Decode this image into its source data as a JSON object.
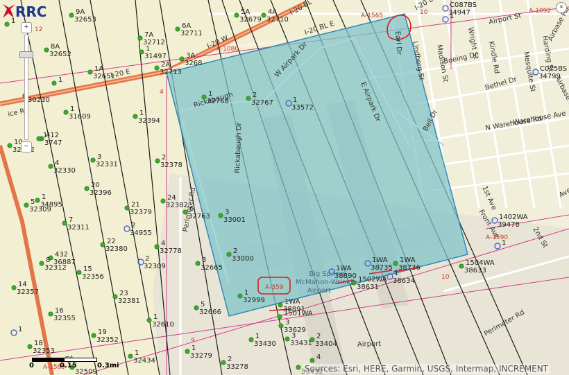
{
  "colors": {
    "background": "#f3efd2",
    "parcel_fill": "#7ec4c9",
    "parcel_stroke": "#2e8ab8",
    "highway": "#e4754b",
    "well_green": "#3cab2b",
    "permit_blue": "#4966c8",
    "survey_line": "#ce3e8b"
  },
  "zoom_control": {
    "plus": "+",
    "minus": "−"
  },
  "scale_bar": {
    "labels": [
      "0",
      "0.15",
      "0.3mi"
    ]
  },
  "attribution": "Sources: Esri, HERE, Garmin, USGS, Intermap, INCREMENT",
  "close_symbol": "×",
  "roads": [
    {
      "text": "I-20 W",
      "rot": -24
    },
    {
      "text": "I-20 E",
      "rot": -12
    },
    {
      "text": "I-20 BL E",
      "rot": -18
    },
    {
      "text": "I-20 BL",
      "rot": -30
    },
    {
      "text": "I-20 E",
      "rot": -30
    },
    {
      "text": "W Airpark Dr",
      "rot": -48
    },
    {
      "text": "E Airpark Dr",
      "rot": 68
    },
    {
      "text": "Rickabaugh Dr",
      "rot": -88
    },
    {
      "text": "Rickabaugh",
      "rot": -16
    },
    {
      "text": "Perimeter Rd",
      "rot": -80
    },
    {
      "text": "Perimeter Rd",
      "rot": -30
    },
    {
      "text": "Bell Dr",
      "rot": -62
    },
    {
      "text": "N Warehouse Rd",
      "rot": -10
    },
    {
      "text": "Warehouse Ave",
      "rot": -10
    },
    {
      "text": "Bethel Dr",
      "rot": -16
    },
    {
      "text": "Boeing Dr",
      "rot": -12
    },
    {
      "text": "Lindberg St",
      "rot": 80
    },
    {
      "text": "Madison St",
      "rot": 80
    },
    {
      "text": "Wright St",
      "rot": 80
    },
    {
      "text": "Kindle Rd",
      "rot": 80
    },
    {
      "text": "Airport St",
      "rot": -12
    },
    {
      "text": "Mesquite St",
      "rot": 80
    },
    {
      "text": "Harding St",
      "rot": 80
    },
    {
      "text": "Airbase Rd",
      "rot": -62
    },
    {
      "text": "Airbase Rd",
      "rot": 62
    },
    {
      "text": "Earl Dr",
      "rot": 86
    },
    {
      "text": "1st Ave",
      "rot": 66
    },
    {
      "text": "Front Ave",
      "rot": 58
    },
    {
      "text": "2nd St",
      "rot": 60
    },
    {
      "text": "Aven",
      "rot": -30
    },
    {
      "text": "Airport",
      "rot": -2
    },
    {
      "text": "Trl",
      "rot": -12
    },
    {
      "text": "ice Rd",
      "rot": -12
    }
  ],
  "survey_labels": [
    "A-1080",
    "A-1590",
    "A-359",
    "A-1589",
    "A-1565",
    "A-1092",
    "4",
    "10",
    "10",
    "9",
    "12"
  ],
  "airport_label": {
    "line1": "Big Spring",
    "line2": "McMahon-Wrinkle",
    "line3": "Airport"
  },
  "wells": [
    {
      "num": "9A",
      "id": "32653",
      "type": "green"
    },
    {
      "num": "6A",
      "id": "32711",
      "type": "green"
    },
    {
      "num": "7A",
      "id": "32712",
      "type": "green"
    },
    {
      "num": "1",
      "id": "31497",
      "type": "green"
    },
    {
      "num": "8A",
      "id": "32652",
      "type": "green"
    },
    {
      "num": "3A",
      "id": "3268",
      "type": "green"
    },
    {
      "num": "2A",
      "id": "32713",
      "type": "green"
    },
    {
      "num": "1A",
      "id": "32651",
      "type": "green"
    },
    {
      "num": "5A",
      "id": "32679",
      "type": "green"
    },
    {
      "num": "4A",
      "id": "32710",
      "type": "green"
    },
    {
      "num": "1",
      "id": "",
      "type": "green"
    },
    {
      "num": "1",
      "id": "",
      "type": "green"
    },
    {
      "num": "",
      "id": "30230",
      "type": "green"
    },
    {
      "num": "1",
      "id": "31609",
      "type": "green"
    },
    {
      "num": "1",
      "id": "32394",
      "type": "green"
    },
    {
      "num": "1",
      "id": "32768",
      "type": "green"
    },
    {
      "num": "2",
      "id": "32767",
      "type": "green"
    },
    {
      "num": "1",
      "id": "33572",
      "type": "blue"
    },
    {
      "num": "10",
      "id": "32332",
      "type": "green"
    },
    {
      "num": "412",
      "id": "3747",
      "type": "green"
    },
    {
      "num": "1",
      "id": "",
      "type": "green"
    },
    {
      "num": "3",
      "id": "32331",
      "type": "green"
    },
    {
      "num": "2",
      "id": "32378",
      "type": "green"
    },
    {
      "num": "4",
      "id": "32330",
      "type": "green"
    },
    {
      "num": "20",
      "id": "32396",
      "type": "green"
    },
    {
      "num": "1",
      "id": "34895",
      "type": "green"
    },
    {
      "num": "5",
      "id": "32309",
      "type": "green"
    },
    {
      "num": "24",
      "id": "32382",
      "type": "green"
    },
    {
      "num": "21",
      "id": "32379",
      "type": "green"
    },
    {
      "num": "6",
      "id": "32763",
      "type": "green"
    },
    {
      "num": "3",
      "id": "33001",
      "type": "green"
    },
    {
      "num": "7",
      "id": "32311",
      "type": "green"
    },
    {
      "num": "2",
      "id": "34955",
      "type": "blue"
    },
    {
      "num": "22",
      "id": "32380",
      "type": "green"
    },
    {
      "num": "4",
      "id": "32778",
      "type": "green"
    },
    {
      "num": "432",
      "id": "36887",
      "type": "green"
    },
    {
      "num": "8",
      "id": "32312",
      "type": "green"
    },
    {
      "num": "2",
      "id": "32309",
      "type": "blue"
    },
    {
      "num": "3",
      "id": "32665",
      "type": "green"
    },
    {
      "num": "2",
      "id": "33000",
      "type": "green"
    },
    {
      "num": "15",
      "id": "32356",
      "type": "green"
    },
    {
      "num": "14",
      "id": "32357",
      "type": "green"
    },
    {
      "num": "23",
      "id": "32381",
      "type": "green"
    },
    {
      "num": "1",
      "id": "32999",
      "type": "green"
    },
    {
      "num": "1WA",
      "id": "38890",
      "type": "blue"
    },
    {
      "num": "1WA",
      "id": "38735",
      "type": "blue"
    },
    {
      "num": "1WA",
      "id": "38736",
      "type": "green"
    },
    {
      "num": "1502WA",
      "id": "38631",
      "type": "green"
    },
    {
      "num": "1",
      "id": "38634",
      "type": "blue"
    },
    {
      "num": "1504WA",
      "id": "38633",
      "type": "green"
    },
    {
      "num": "1WA",
      "id": "38891",
      "type": "green"
    },
    {
      "num": "5",
      "id": "32666",
      "type": "green"
    },
    {
      "num": "16",
      "id": "32355",
      "type": "green"
    },
    {
      "num": "1",
      "id": "32610",
      "type": "green"
    },
    {
      "num": "1501WA",
      "id": "",
      "type": "green"
    },
    {
      "num": "3",
      "id": "33629",
      "type": "green"
    },
    {
      "num": "19",
      "id": "32352",
      "type": "green"
    },
    {
      "num": "1",
      "id": "",
      "type": "blue"
    },
    {
      "num": "1",
      "id": "33430",
      "type": "green"
    },
    {
      "num": "3",
      "id": "33431",
      "type": "green"
    },
    {
      "num": "2",
      "id": "33404",
      "type": "green"
    },
    {
      "num": "18",
      "id": "32353",
      "type": "green"
    },
    {
      "num": "1",
      "id": "32434",
      "type": "green"
    },
    {
      "num": "1",
      "id": "33279",
      "type": "green"
    },
    {
      "num": "2",
      "id": "33278",
      "type": "green"
    },
    {
      "num": "4",
      "id": "",
      "type": "green"
    },
    {
      "num": "",
      "id": "32509",
      "type": "green"
    },
    {
      "num": "",
      "id": "33432",
      "type": "green"
    },
    {
      "num": "C087BS",
      "id": "34947",
      "type": "blue"
    },
    {
      "num": "1",
      "id": "",
      "type": "blue"
    },
    {
      "num": "C075BS",
      "id": "34799",
      "type": "blue"
    },
    {
      "num": "1402WA",
      "id": "39478",
      "type": "blue"
    },
    {
      "num": "1",
      "id": "",
      "type": "blue"
    }
  ],
  "logo": {
    "text": "RRC",
    "stripe_colors": [
      "#c8102e",
      "#1a3a8f"
    ]
  }
}
